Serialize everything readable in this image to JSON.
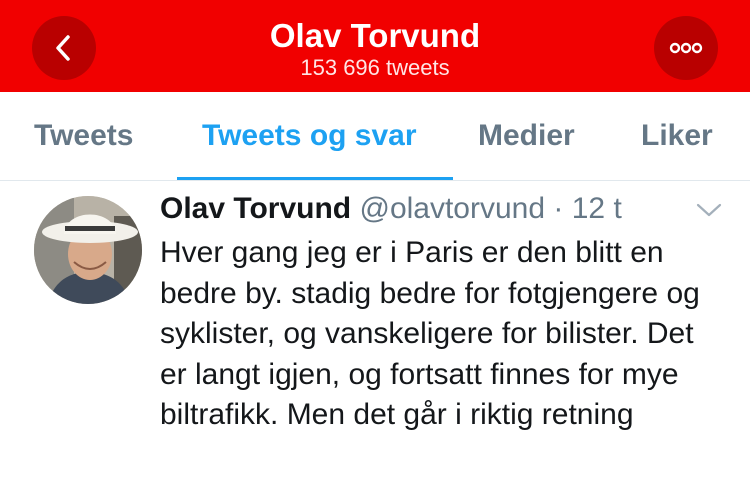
{
  "header": {
    "title": "Olav Torvund",
    "subtitle": "153 696 tweets",
    "back_icon": "chevron-left-icon",
    "more_icon": "ellipsis-icon",
    "color": "#f10000"
  },
  "tabs": [
    {
      "label": "Tweets",
      "active": false
    },
    {
      "label": "Tweets og svar",
      "active": true
    },
    {
      "label": "Medier",
      "active": false
    },
    {
      "label": "Liker",
      "active": false
    }
  ],
  "tweet": {
    "display_name": "Olav Torvund",
    "handle": "@olavtorvund",
    "separator": "·",
    "time": "12 t",
    "text": "Hver gang jeg er i Paris er den blitt en bedre by. stadig bedre for fotgjengere og syklister, og vanskeligere for bilister. Det er langt igjen, og fortsatt finnes for mye biltrafikk. Men det går i riktig retning"
  },
  "colors": {
    "accent": "#1da1f2",
    "header_red": "#f10000",
    "text_primary": "#14171a",
    "text_secondary": "#657786"
  }
}
